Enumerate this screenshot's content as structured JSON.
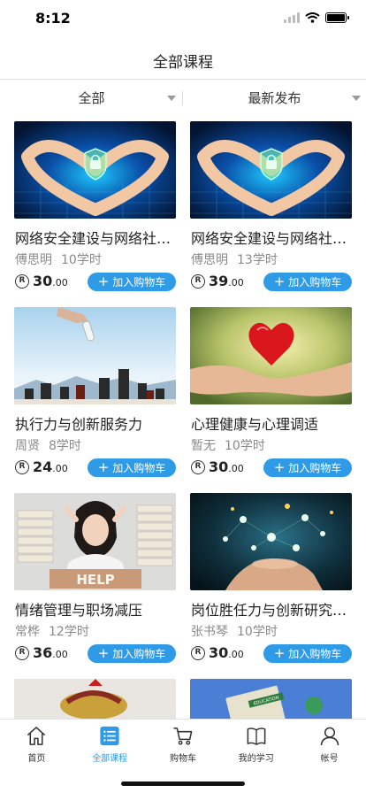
{
  "status_bar": {
    "time": "8:12"
  },
  "header": {
    "title": "全部课程"
  },
  "filters": {
    "category": "全部",
    "sort": "最新发布"
  },
  "currency_symbol": "R",
  "courses": [
    {
      "title": "网络安全建设与网络社会治理",
      "teacher": "傅思明",
      "hours": "10学时",
      "price_int": "30",
      "price_dec": ".00",
      "button": "加入购物车"
    },
    {
      "title": "网络安全建设与网络社会治理",
      "teacher": "傅思明",
      "hours": "13学时",
      "price_int": "39",
      "price_dec": ".00",
      "button": "加入购物车"
    },
    {
      "title": "执行力与创新服务力",
      "teacher": "周贤",
      "hours": "8学时",
      "price_int": "24",
      "price_dec": ".00",
      "button": "加入购物车"
    },
    {
      "title": "心理健康与心理调适",
      "teacher": "暂无",
      "hours": "10学时",
      "price_int": "30",
      "price_dec": ".00",
      "button": "加入购物车"
    },
    {
      "title": "情绪管理与职场减压",
      "teacher": "常桦",
      "hours": "12学时",
      "price_int": "36",
      "price_dec": ".00",
      "button": "加入购物车"
    },
    {
      "title": "岗位胜任力与创新研究实践",
      "teacher": "张书琴",
      "hours": "10学时",
      "price_int": "30",
      "price_dec": ".00",
      "button": "加入购物车"
    }
  ],
  "thumb_texts": {
    "help": "HELP",
    "education": "EDUCATION"
  },
  "tabbar": [
    {
      "label": "首页",
      "icon": "home-icon"
    },
    {
      "label": "全部课程",
      "icon": "list-icon",
      "active": true
    },
    {
      "label": "购物车",
      "icon": "cart-icon"
    },
    {
      "label": "我的学习",
      "icon": "book-icon"
    },
    {
      "label": "帐号",
      "icon": "person-icon"
    }
  ],
  "colors": {
    "accent": "#2f9ae6"
  }
}
